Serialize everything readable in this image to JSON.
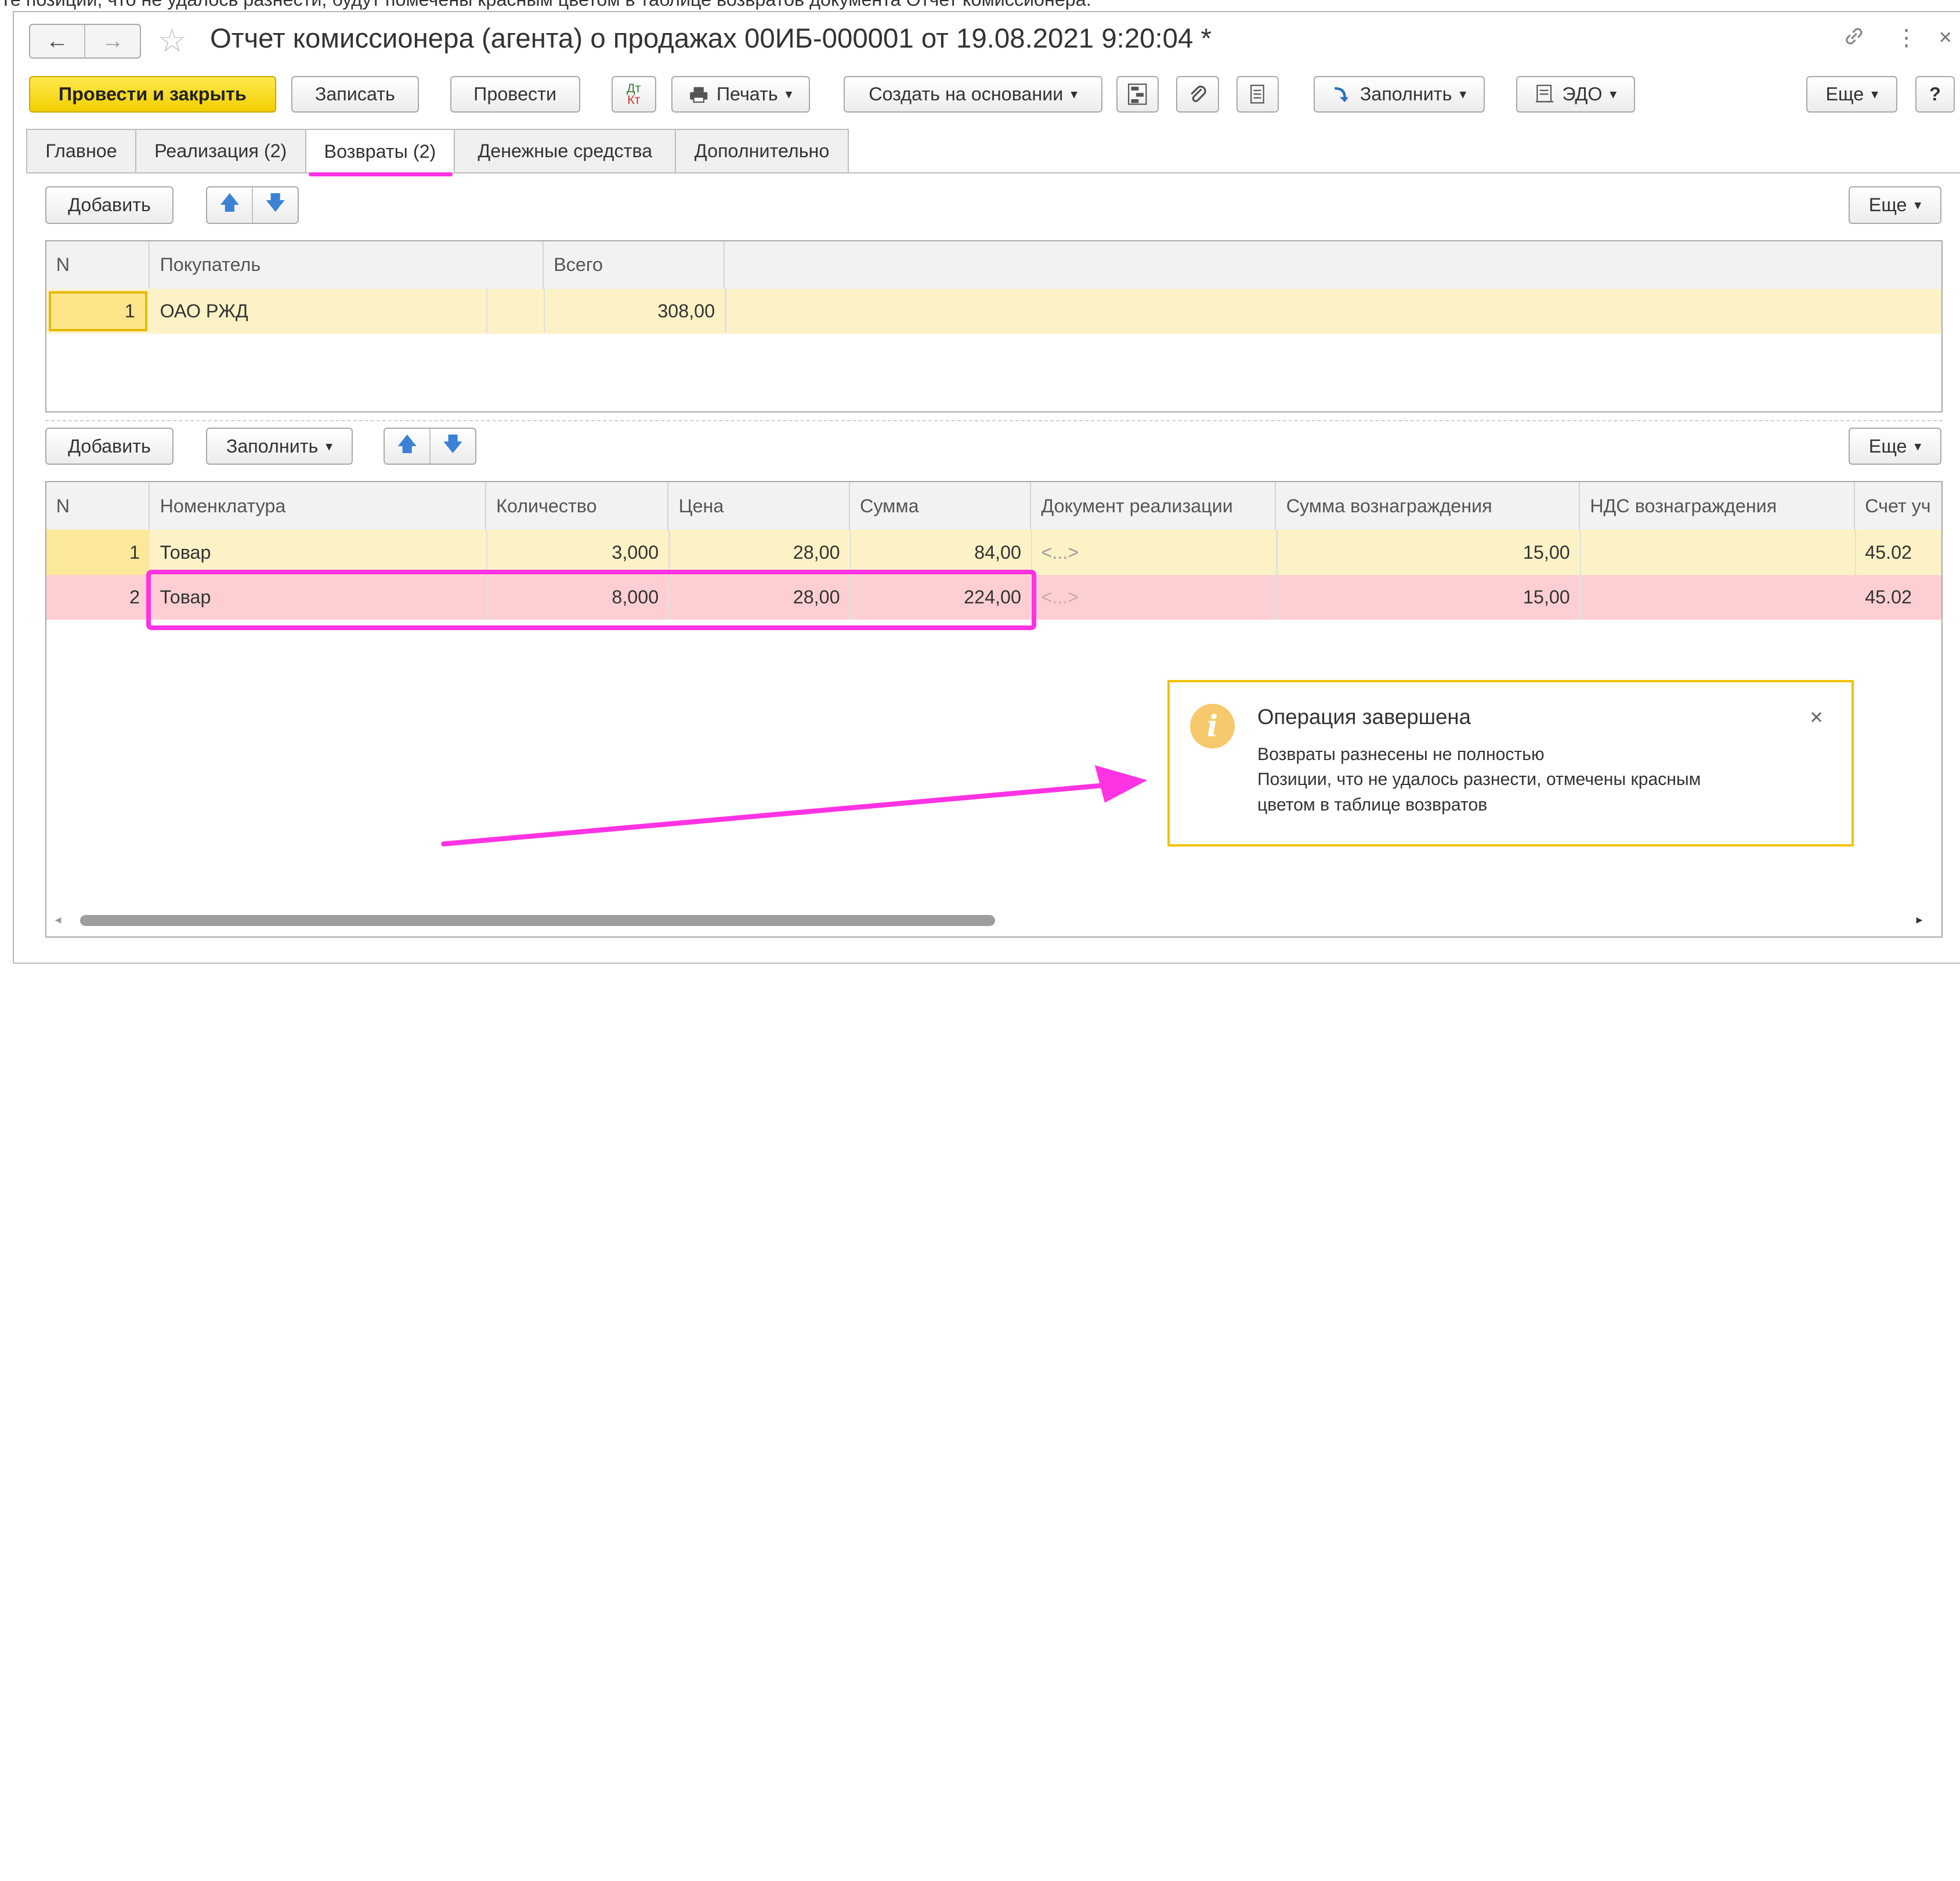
{
  "caption": "Те позиции, что не удалось разнести, будут помечены красным цветом в таблице возвратов документа Отчет комиссионера.",
  "header": {
    "back_icon": "←",
    "forward_icon": "→",
    "star_icon": "☆",
    "title": "Отчет комиссионера (агента) о продажах 00ИБ-000001 от 19.08.2021 9:20:04 *",
    "link_icon": "🔗",
    "menu_icon": "⋮",
    "close_icon": "×"
  },
  "toolbar": {
    "post_close": "Провести и закрыть",
    "save": "Записать",
    "post": "Провести",
    "dt_kt_top": "Дт",
    "dt_kt_bottom": "Кт",
    "print": "Печать",
    "create_based": "Создать на основании",
    "fill": "Заполнить",
    "edo": "ЭДО",
    "more": "Еще",
    "help": "?",
    "dropdown": "▾"
  },
  "tabs": [
    {
      "label": "Главное"
    },
    {
      "label": "Реализация (2)"
    },
    {
      "label": "Возвраты (2)"
    },
    {
      "label": "Денежные средства"
    },
    {
      "label": "Дополнительно"
    }
  ],
  "buyers": {
    "add": "Добавить",
    "more": "Еще",
    "up_icon": "🡅",
    "down_icon": "🡇",
    "headers": {
      "n": "N",
      "buyer": "Покупатель",
      "total": "Всего"
    },
    "rows": [
      {
        "n": "1",
        "buyer": "ОАО РЖД",
        "total": "308,00"
      }
    ]
  },
  "items": {
    "add": "Добавить",
    "fill": "Заполнить",
    "more": "Еще",
    "headers": {
      "n": "N",
      "nomenclature": "Номенклатура",
      "qty": "Количество",
      "price": "Цена",
      "sum": "Сумма",
      "doc": "Документ реализации",
      "reward_sum": "Сумма вознаграждения",
      "reward_vat": "НДС вознаграждения",
      "account": "Счет уч"
    },
    "rows": [
      {
        "n": "1",
        "nomenclature": "Товар",
        "qty": "3,000",
        "price": "28,00",
        "sum": "84,00",
        "doc": "<...>",
        "reward_sum": "15,00",
        "reward_vat": "",
        "account": "45.02"
      },
      {
        "n": "2",
        "nomenclature": "Товар",
        "qty": "8,000",
        "price": "28,00",
        "sum": "224,00",
        "doc": "<...>",
        "reward_sum": "15,00",
        "reward_vat": "",
        "account": "45.02"
      }
    ]
  },
  "popup": {
    "icon": "i",
    "title": "Операция завершена",
    "close": "×",
    "line1": "Возвраты разнесены не полностью",
    "line2": "Позиции, что не удалось разнести, отмечены красным",
    "line3": "цветом в таблице возвратов"
  },
  "colors": {
    "accent_yellow": "#f1cf00",
    "highlight_row": "#fdf2c6",
    "error_row": "#fdcfd3",
    "annotation_magenta": "#ff33e3",
    "popup_border": "#f2c200"
  }
}
